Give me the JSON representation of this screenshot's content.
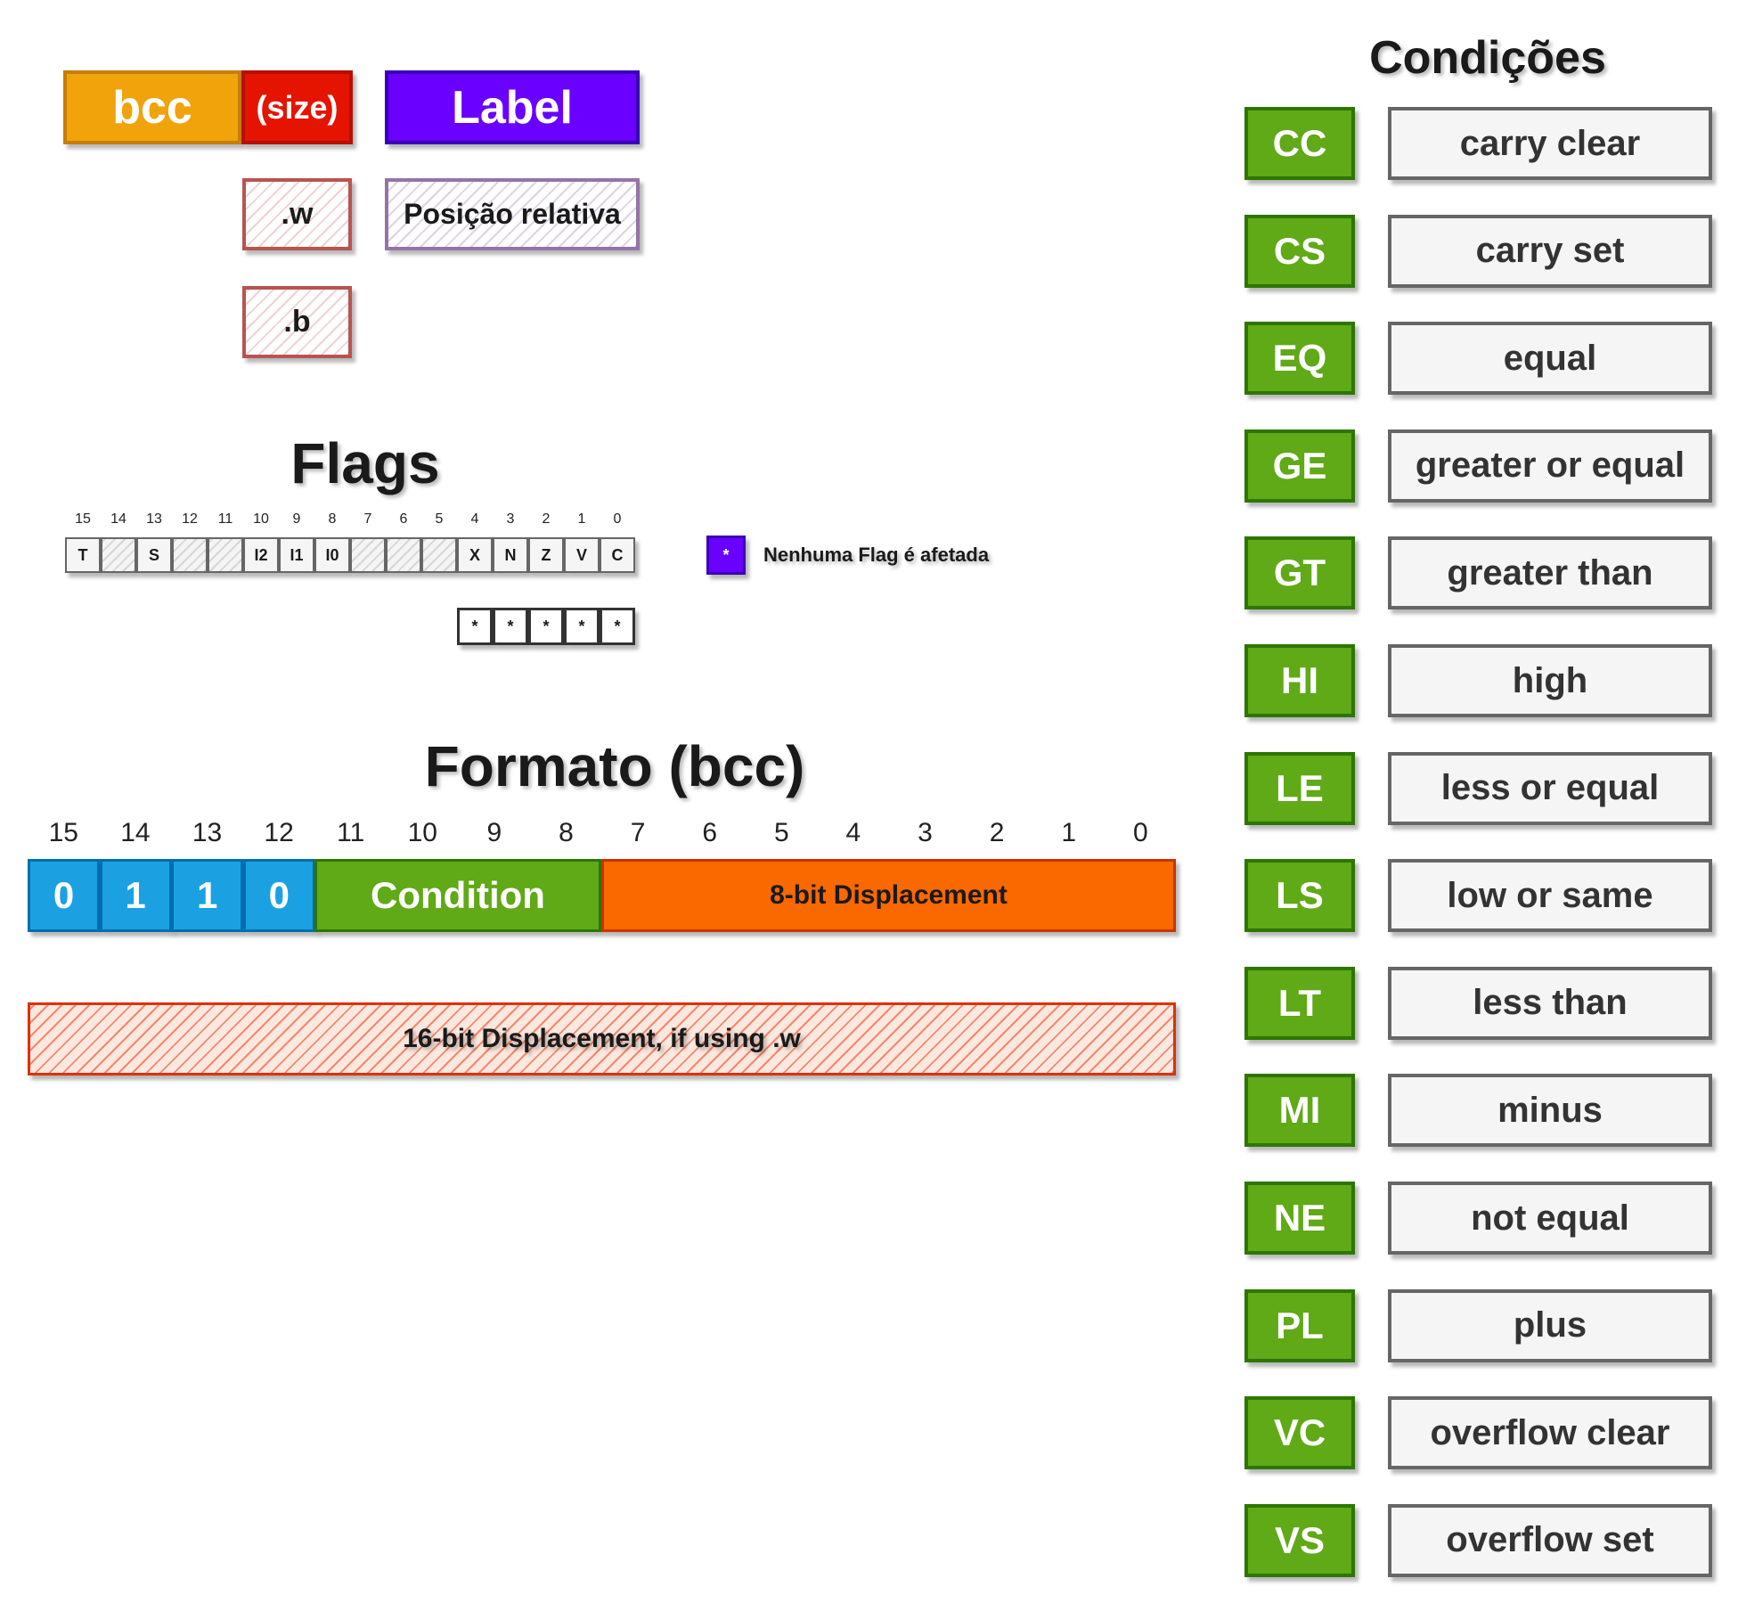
{
  "syntax": {
    "mnemonic": "bcc",
    "size": "(size)",
    "operand": "Label",
    "size_word": ".w",
    "size_byte": ".b",
    "operand_desc": "Posição relativa"
  },
  "flags": {
    "title": "Flags",
    "bit_numbers": [
      "15",
      "14",
      "13",
      "12",
      "11",
      "10",
      "9",
      "8",
      "7",
      "6",
      "5",
      "4",
      "3",
      "2",
      "1",
      "0"
    ],
    "register": [
      "T",
      "",
      "S",
      "",
      "",
      "I2",
      "I1",
      "I0",
      "",
      "",
      "",
      "X",
      "N",
      "Z",
      "V",
      "C"
    ],
    "effects": [
      "*",
      "*",
      "*",
      "*",
      "*"
    ],
    "legend_symbol": "*",
    "legend_text": "Nenhuma Flag é afetada"
  },
  "format": {
    "title": "Formato (bcc)",
    "bit_numbers": [
      "15",
      "14",
      "13",
      "12",
      "11",
      "10",
      "9",
      "8",
      "7",
      "6",
      "5",
      "4",
      "3",
      "2",
      "1",
      "0"
    ],
    "opcode_bits": [
      "0",
      "1",
      "1",
      "0"
    ],
    "condition_label": "Condition",
    "displacement8_label": "8-bit Displacement",
    "displacement16_label": "16-bit Displacement, if using .w"
  },
  "conditions": {
    "title": "Condições",
    "items": [
      {
        "code": "CC",
        "desc": "carry clear"
      },
      {
        "code": "CS",
        "desc": "carry set"
      },
      {
        "code": "EQ",
        "desc": "equal"
      },
      {
        "code": "GE",
        "desc": "greater or equal"
      },
      {
        "code": "GT",
        "desc": "greater than"
      },
      {
        "code": "HI",
        "desc": "high"
      },
      {
        "code": "LE",
        "desc": "less or equal"
      },
      {
        "code": "LS",
        "desc": "low or same"
      },
      {
        "code": "LT",
        "desc": "less than"
      },
      {
        "code": "MI",
        "desc": "minus"
      },
      {
        "code": "NE",
        "desc": "not equal"
      },
      {
        "code": "PL",
        "desc": "plus"
      },
      {
        "code": "VC",
        "desc": "overflow clear"
      },
      {
        "code": "VS",
        "desc": "overflow set"
      }
    ]
  },
  "colors": {
    "mnemonic": "#f0a30a",
    "size": "#e51400",
    "operand": "#6a00ff",
    "opcode": "#1ba1e2",
    "condition": "#60a917",
    "displacement": "#fa6800"
  }
}
